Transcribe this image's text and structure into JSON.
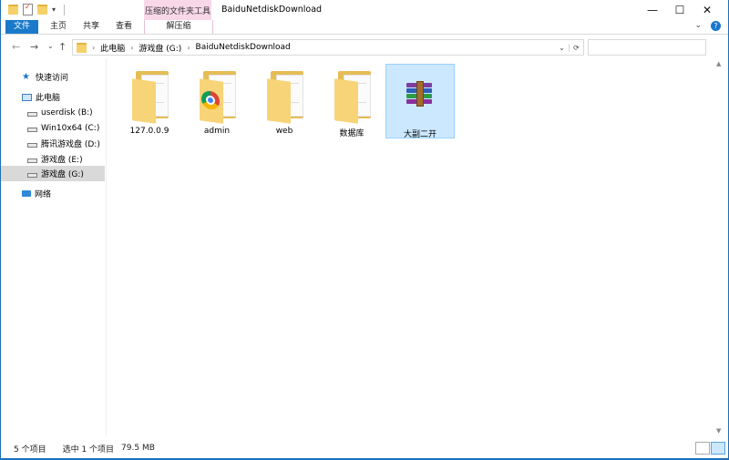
{
  "window": {
    "title": "BaiduNetdiskDownload",
    "context_group": "压缩的文件夹工具",
    "controls": {
      "minimize": "—",
      "maximize": "☐",
      "close": "✕"
    }
  },
  "ribbon": {
    "tabs": [
      {
        "label": "文件",
        "selected": true
      },
      {
        "label": "主页"
      },
      {
        "label": "共享"
      },
      {
        "label": "查看"
      },
      {
        "label": "解压缩"
      }
    ],
    "expand_glyph": "⌄",
    "help_glyph": "?"
  },
  "address": {
    "crumbs": [
      "此电脑",
      "游戏盘 (G:)",
      "BaiduNetdiskDownload"
    ],
    "search_placeholder": ""
  },
  "nav_pane": {
    "quick_access": "快速访问",
    "this_pc": "此电脑",
    "drives": [
      {
        "label": "userdisk (B:)"
      },
      {
        "label": "Win10x64 (C:)"
      },
      {
        "label": "腾讯游戏盘 (D:)"
      },
      {
        "label": "游戏盘 (E:)"
      },
      {
        "label": "游戏盘 (G:)",
        "selected": true
      }
    ],
    "network": "网络"
  },
  "files": [
    {
      "name": "127.0.0.9",
      "type": "folder"
    },
    {
      "name": "admin",
      "type": "folder-chrome"
    },
    {
      "name": "web",
      "type": "folder"
    },
    {
      "name": "数据库",
      "type": "folder"
    },
    {
      "name": "大副二开",
      "type": "rar-archive",
      "selected": true
    }
  ],
  "status": {
    "count": "5 个项目",
    "selection": "选中 1 个项目",
    "size": "79.5 MB"
  },
  "colors": {
    "accent": "#1979ca",
    "context_tab": "#f8d7e8",
    "selection": "#cce8ff",
    "folder": "#f8d478",
    "desktop": "#1e6fb5"
  }
}
